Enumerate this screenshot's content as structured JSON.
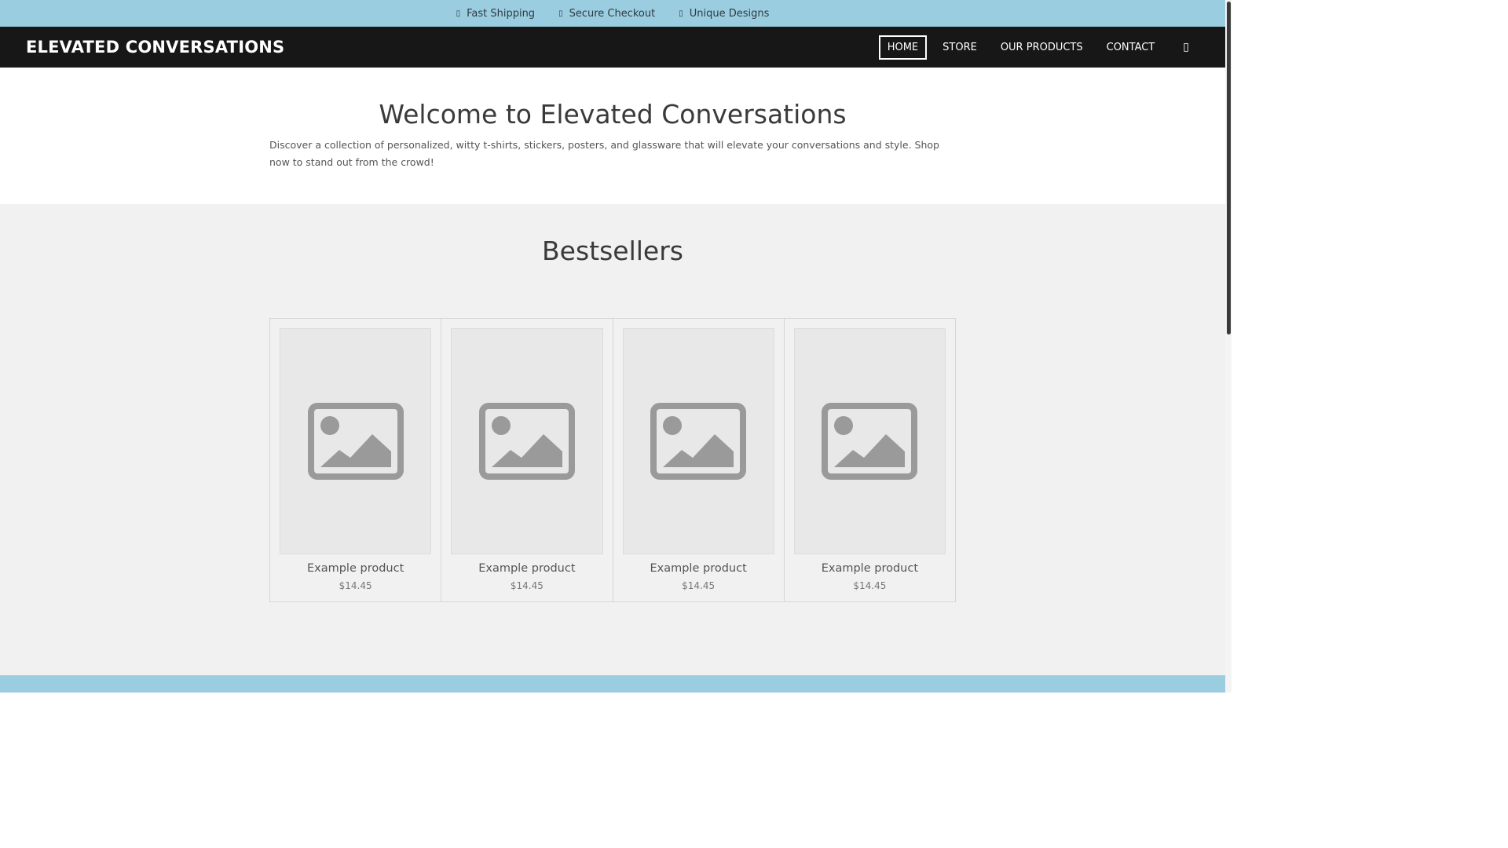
{
  "topbar": {
    "items": [
      {
        "icon": "truck-icon",
        "label": "Fast Shipping"
      },
      {
        "icon": "lock-icon",
        "label": "Secure Checkout"
      },
      {
        "icon": "star-icon",
        "label": "Unique Designs"
      }
    ]
  },
  "header": {
    "brand": "ELEVATED CONVERSATIONS",
    "menu": {
      "home": "HOME",
      "store": "STORE",
      "products": "OUR PRODUCTS",
      "contact": "CONTACT"
    },
    "cart_icon": "cart-icon"
  },
  "welcome": {
    "title": "Welcome to Elevated Conversations",
    "text": "Discover a collection of personalized, witty t-shirts, stickers, posters, and glassware that will elevate your conversations and style. Shop now to stand out from the crowd!"
  },
  "bestsellers": {
    "title": "Bestsellers",
    "products": [
      {
        "name": "Example product",
        "price": "$14.45"
      },
      {
        "name": "Example product",
        "price": "$14.45"
      },
      {
        "name": "Example product",
        "price": "$14.45"
      },
      {
        "name": "Example product",
        "price": "$14.45"
      }
    ]
  },
  "colors": {
    "topbar_bg": "#9bcde0",
    "nav_bg": "#171717",
    "section_bg": "#f1f1f1"
  }
}
